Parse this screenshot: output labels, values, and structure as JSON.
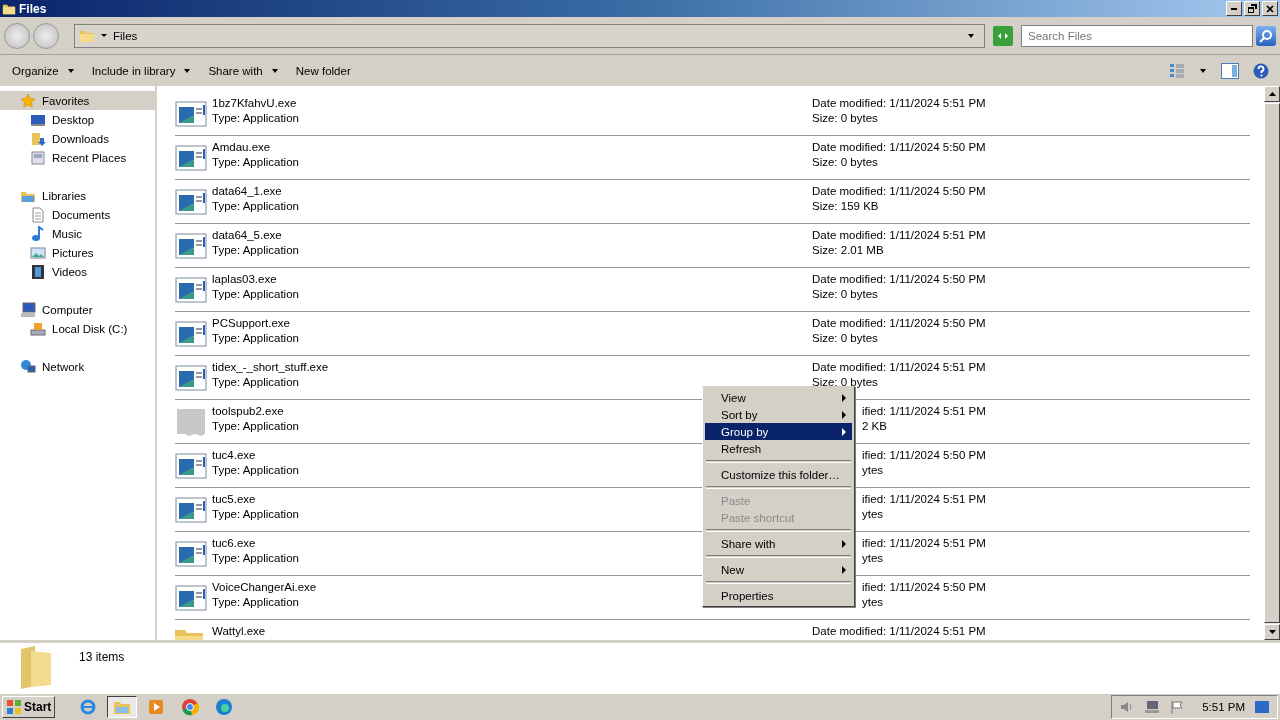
{
  "window": {
    "title": "Files"
  },
  "address": {
    "path": "Files",
    "search_placeholder": "Search Files"
  },
  "toolbar": {
    "buttons": [
      {
        "label": "Organize",
        "dropdown": true
      },
      {
        "label": "Include in library",
        "dropdown": true
      },
      {
        "label": "Share with",
        "dropdown": true
      },
      {
        "label": "New folder",
        "dropdown": false
      }
    ]
  },
  "sidebar": {
    "groups": [
      {
        "label": "Favorites",
        "selected": true,
        "children": [
          {
            "label": "Desktop",
            "selected": false
          },
          {
            "label": "Downloads",
            "selected": false
          },
          {
            "label": "Recent Places",
            "selected": false
          }
        ]
      },
      {
        "label": "Libraries",
        "selected": false,
        "children": [
          {
            "label": "Documents",
            "selected": false
          },
          {
            "label": "Music",
            "selected": false
          },
          {
            "label": "Pictures",
            "selected": false
          },
          {
            "label": "Videos",
            "selected": false
          }
        ]
      },
      {
        "label": "Computer",
        "selected": false,
        "children": [
          {
            "label": "Local Disk (C:)",
            "selected": false
          }
        ]
      },
      {
        "label": "Network",
        "selected": false
      }
    ]
  },
  "files": [
    {
      "name": "1bz7KfahvU.exe",
      "type": "Type: Application",
      "date": "Date modified: 1/11/2024 5:51 PM",
      "size": "Size: 0 bytes",
      "kind": "app",
      "clipped": false
    },
    {
      "name": "Amdau.exe",
      "type": "Type: Application",
      "date": "Date modified: 1/11/2024 5:50 PM",
      "size": "Size: 0 bytes",
      "kind": "app",
      "clipped": false
    },
    {
      "name": "data64_1.exe",
      "type": "Type: Application",
      "date": "Date modified: 1/11/2024 5:50 PM",
      "size": "Size: 159 KB",
      "kind": "app",
      "clipped": false
    },
    {
      "name": "data64_5.exe",
      "type": "Type: Application",
      "date": "Date modified: 1/11/2024 5:51 PM",
      "size": "Size: 2.01 MB",
      "kind": "app",
      "clipped": false
    },
    {
      "name": "laplas03.exe",
      "type": "Type: Application",
      "date": "Date modified: 1/11/2024 5:50 PM",
      "size": "Size: 0 bytes",
      "kind": "app",
      "clipped": false
    },
    {
      "name": "PCSupport.exe",
      "type": "Type: Application",
      "date": "Date modified: 1/11/2024 5:50 PM",
      "size": "Size: 0 bytes",
      "kind": "app",
      "clipped": false
    },
    {
      "name": "tidex_-_short_stuff.exe",
      "type": "Type: Application",
      "date": "Date modified: 1/11/2024 5:51 PM",
      "size": "Size: 0 bytes",
      "kind": "app",
      "clipped": false
    },
    {
      "name": "toolspub2.exe",
      "type": "Type: Application",
      "date": "ified: 1/11/2024 5:51 PM",
      "size": "2 KB",
      "kind": "blank",
      "clipped": true
    },
    {
      "name": "tuc4.exe",
      "type": "Type: Application",
      "date": "ified: 1/11/2024 5:50 PM",
      "size": "ytes",
      "kind": "app",
      "clipped": true
    },
    {
      "name": "tuc5.exe",
      "type": "Type: Application",
      "date": "ified: 1/11/2024 5:51 PM",
      "size": "ytes",
      "kind": "app",
      "clipped": true
    },
    {
      "name": "tuc6.exe",
      "type": "Type: Application",
      "date": "ified: 1/11/2024 5:51 PM",
      "size": "ytes",
      "kind": "app",
      "clipped": true
    },
    {
      "name": "VoiceChangerAi.exe",
      "type": "Type: Application",
      "date": "ified: 1/11/2024 5:50 PM",
      "size": "ytes",
      "kind": "app",
      "clipped": true
    },
    {
      "name": "Wattyl.exe",
      "date": "Date modified: 1/11/2024 5:51 PM",
      "kind": "folder",
      "clipped": false
    }
  ],
  "context_menu": {
    "groups": [
      [
        {
          "label": "View",
          "submenu": true,
          "selected": false,
          "disabled": false
        },
        {
          "label": "Sort by",
          "submenu": true,
          "selected": false,
          "disabled": false
        },
        {
          "label": "Group by",
          "submenu": true,
          "selected": true,
          "disabled": false
        },
        {
          "label": "Refresh",
          "submenu": false,
          "selected": false,
          "disabled": false
        }
      ],
      [
        {
          "label": "Customize this folder…",
          "submenu": false,
          "selected": false,
          "disabled": false
        }
      ],
      [
        {
          "label": "Paste",
          "submenu": false,
          "selected": false,
          "disabled": true
        },
        {
          "label": "Paste shortcut",
          "submenu": false,
          "selected": false,
          "disabled": true
        }
      ],
      [
        {
          "label": "Share with",
          "submenu": true,
          "selected": false,
          "disabled": false
        }
      ],
      [
        {
          "label": "New",
          "submenu": true,
          "selected": false,
          "disabled": false
        }
      ],
      [
        {
          "label": "Properties",
          "submenu": false,
          "selected": false,
          "disabled": false
        }
      ]
    ]
  },
  "details": {
    "count": "13 items"
  },
  "taskbar": {
    "start": "Start",
    "apps": [
      {
        "kind": "ie",
        "selected": false
      },
      {
        "kind": "explorer",
        "selected": true
      },
      {
        "kind": "media",
        "selected": false
      },
      {
        "kind": "chrome",
        "selected": false
      },
      {
        "kind": "edge",
        "selected": false
      }
    ],
    "clock": "5:51 PM"
  }
}
